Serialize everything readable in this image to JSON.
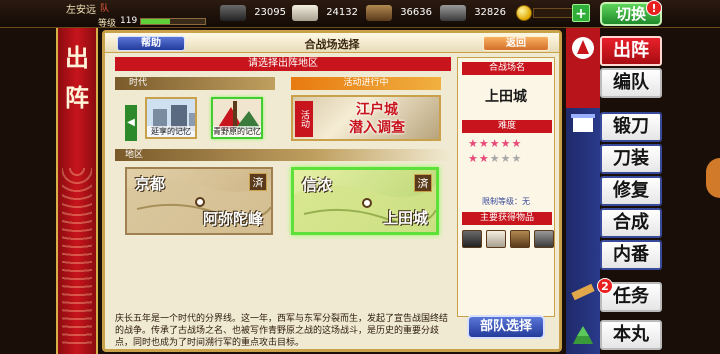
{
  "player": {
    "name": "左安远",
    "unit_icon": "队",
    "level_label": "等级",
    "level": "119",
    "exp_fraction": 0.45
  },
  "resources": [
    {
      "name": "charcoal",
      "value": "23095",
      "color": "#4a4a4a"
    },
    {
      "name": "steel",
      "value": "24132",
      "color": "#d8d0b8"
    },
    {
      "name": "cooling-material",
      "value": "36636",
      "color": "#8a6a3a"
    },
    {
      "name": "whetstone",
      "value": "32826",
      "color": "#6a6a6a"
    }
  ],
  "topbar": {
    "plus": "+",
    "switch_label": "切换",
    "switch_badge": "!"
  },
  "banner": {
    "line1": "出",
    "line2": "阵"
  },
  "panel": {
    "title": "合战场选择",
    "help": "帮助",
    "back": "返回",
    "region_prompt": "请选择出阵地区",
    "era_label": "时代",
    "event_label": "活动进行中",
    "era_arrow": "◀",
    "eras": [
      {
        "caption": "延享的记忆",
        "selected": false
      },
      {
        "caption": "青野原的记忆",
        "selected": true
      }
    ],
    "event": {
      "tag": "活动",
      "line1": "江户城",
      "line2": "潜入调查"
    },
    "area_label": "地区",
    "maps": [
      {
        "name1": "京都",
        "name2": "阿弥陀峰",
        "badge": "済",
        "selected": false
      },
      {
        "name1": "信浓",
        "name2": "上田城",
        "badge": "済",
        "selected": true
      }
    ],
    "description": "庆长五年是一个时代的分界线。这一年，西军与东军分裂而生，发起了宣告战国终结的战争。传承了古战场之名、也被写作青野原之战的这场战斗，是历史的重要分歧点，同时也成为了时间溯行军的重点攻击目标。"
  },
  "info": {
    "header": "合战场名",
    "castle": "上田城",
    "difficulty_label": "难度",
    "difficulty": 7,
    "difficulty_max": 10,
    "limit": "限制等级：无",
    "items_label": "主要获得物品",
    "items": [
      "charcoal",
      "steel",
      "cooling-material",
      "whetstone"
    ]
  },
  "squad_button": "部队选择",
  "menu": [
    {
      "label": "出阵",
      "active": true
    },
    {
      "label": "编队",
      "active": false
    },
    {
      "label": "锻刀",
      "active": false
    },
    {
      "label": "刀装",
      "active": false
    },
    {
      "label": "修复",
      "active": false
    },
    {
      "label": "合成",
      "active": false
    },
    {
      "label": "内番",
      "active": false
    },
    {
      "label": "任务",
      "active": false,
      "badge": "2"
    },
    {
      "label": "本丸",
      "active": false
    }
  ]
}
